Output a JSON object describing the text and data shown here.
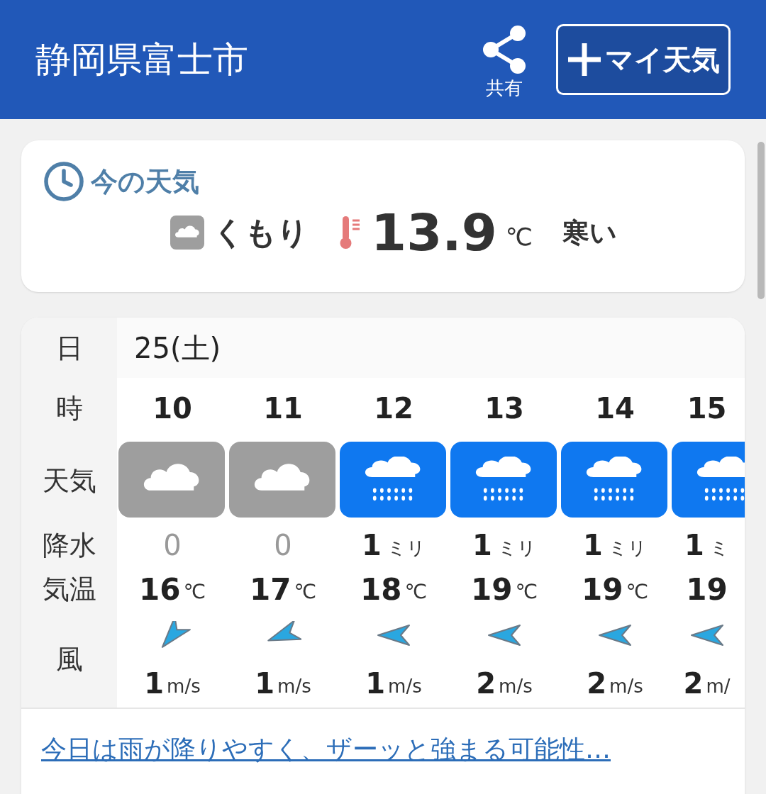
{
  "header": {
    "title": "静岡県富士市",
    "share_label": "共有",
    "my_weather_button": "マイ天気"
  },
  "now": {
    "heading": "今の天気",
    "weather": "くもり",
    "kind": "cloudy",
    "temperature": "13.9",
    "temp_unit": "℃",
    "feeling": "寒い"
  },
  "forecast": {
    "row_labels": {
      "date": "日",
      "hour": "時",
      "weather": "天気",
      "precip": "降水",
      "temp": "気温",
      "wind": "風"
    },
    "date": "25(土)",
    "hours": [
      {
        "hour": "10",
        "kind": "cloudy",
        "precip": "0",
        "temp": "16",
        "temp_unit": "℃",
        "wind": {
          "kind": "sw",
          "speed": "1",
          "unit": "m/s"
        }
      },
      {
        "hour": "11",
        "kind": "cloudy",
        "precip": "0",
        "temp": "17",
        "temp_unit": "℃",
        "wind": {
          "kind": "wsw",
          "speed": "1",
          "unit": "m/s"
        }
      },
      {
        "hour": "12",
        "kind": "rain",
        "precip": "1",
        "precip_unit": "ミリ",
        "temp": "18",
        "temp_unit": "℃",
        "wind": {
          "kind": "w",
          "speed": "1",
          "unit": "m/s"
        }
      },
      {
        "hour": "13",
        "kind": "rain",
        "precip": "1",
        "precip_unit": "ミリ",
        "temp": "19",
        "temp_unit": "℃",
        "wind": {
          "kind": "w",
          "speed": "2",
          "unit": "m/s"
        }
      },
      {
        "hour": "14",
        "kind": "rain",
        "precip": "1",
        "precip_unit": "ミリ",
        "temp": "19",
        "temp_unit": "℃",
        "wind": {
          "kind": "w",
          "speed": "2",
          "unit": "m/s"
        }
      },
      {
        "hour": "15",
        "kind": "rain",
        "precip": "1",
        "precip_unit": "ミ",
        "temp": "19",
        "wind": {
          "kind": "w",
          "speed": "2",
          "unit": "m/"
        }
      }
    ],
    "link": "今日は雨が降りやすく、ザーッと強まる可能性…"
  }
}
